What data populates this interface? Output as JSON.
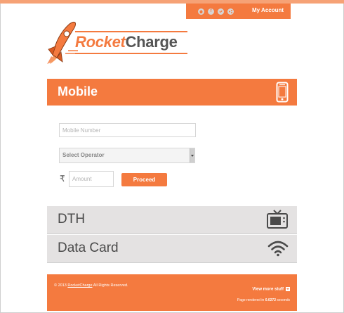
{
  "header": {
    "my_account_label": "My Account",
    "social_icons": [
      "home-icon",
      "facebook-icon",
      "twitter-icon",
      "share-icon"
    ]
  },
  "brand": {
    "name_part1": "Rocket",
    "name_part2": "Charge",
    "logo_icon": "rocket-icon"
  },
  "sections": {
    "mobile": {
      "title": "Mobile",
      "icon": "smartphone-icon",
      "form": {
        "mobile_placeholder": "Mobile Number",
        "operator_selected": "Select Operator",
        "currency_symbol": "₹",
        "amount_placeholder": "Amount",
        "proceed_label": "Proceed"
      }
    },
    "dth": {
      "title": "DTH",
      "icon": "tv-icon"
    },
    "data_card": {
      "title": "Data Card",
      "icon": "wifi-icon"
    }
  },
  "footer": {
    "copyright_prefix": "© 2013 ",
    "copyright_brand": "RocketCharge",
    "copyright_suffix": " All Rights Reserved.",
    "view_more_label": "View more stuff",
    "render_prefix": "Page rendered in ",
    "render_time": "0.0272",
    "render_suffix": " seconds"
  },
  "colors": {
    "accent": "#f47a3f",
    "panel_gray": "#e4e2e2",
    "text_dark": "#4a4a4a"
  }
}
